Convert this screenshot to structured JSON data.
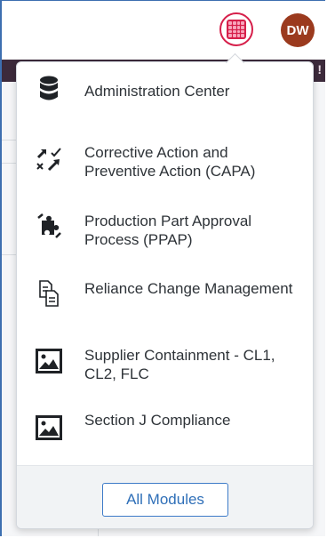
{
  "header": {
    "avatar_initials": "DW",
    "banner_trailing_text": "!"
  },
  "menu": {
    "items": [
      {
        "label": "Administration Center",
        "icon": "database-icon"
      },
      {
        "label": "Corrective Action and Preventive Action (CAPA)",
        "icon": "check-x-arrows-icon"
      },
      {
        "label": "Production Part Approval Process (PPAP)",
        "icon": "puzzle-piece-icon"
      },
      {
        "label": "Reliance Change Management",
        "icon": "document-copy-icon"
      },
      {
        "label": "Supplier Containment - CL1, CL2, FLC",
        "icon": "image-icon"
      },
      {
        "label": "Section J Compliance",
        "icon": "image-icon"
      }
    ],
    "all_modules_label": "All Modules"
  },
  "colors": {
    "apps_button_accent": "#d61f4a",
    "avatar_bg": "#9b3a1e",
    "banner_bg": "#3c2a3b",
    "link_blue": "#2f6fb8"
  }
}
